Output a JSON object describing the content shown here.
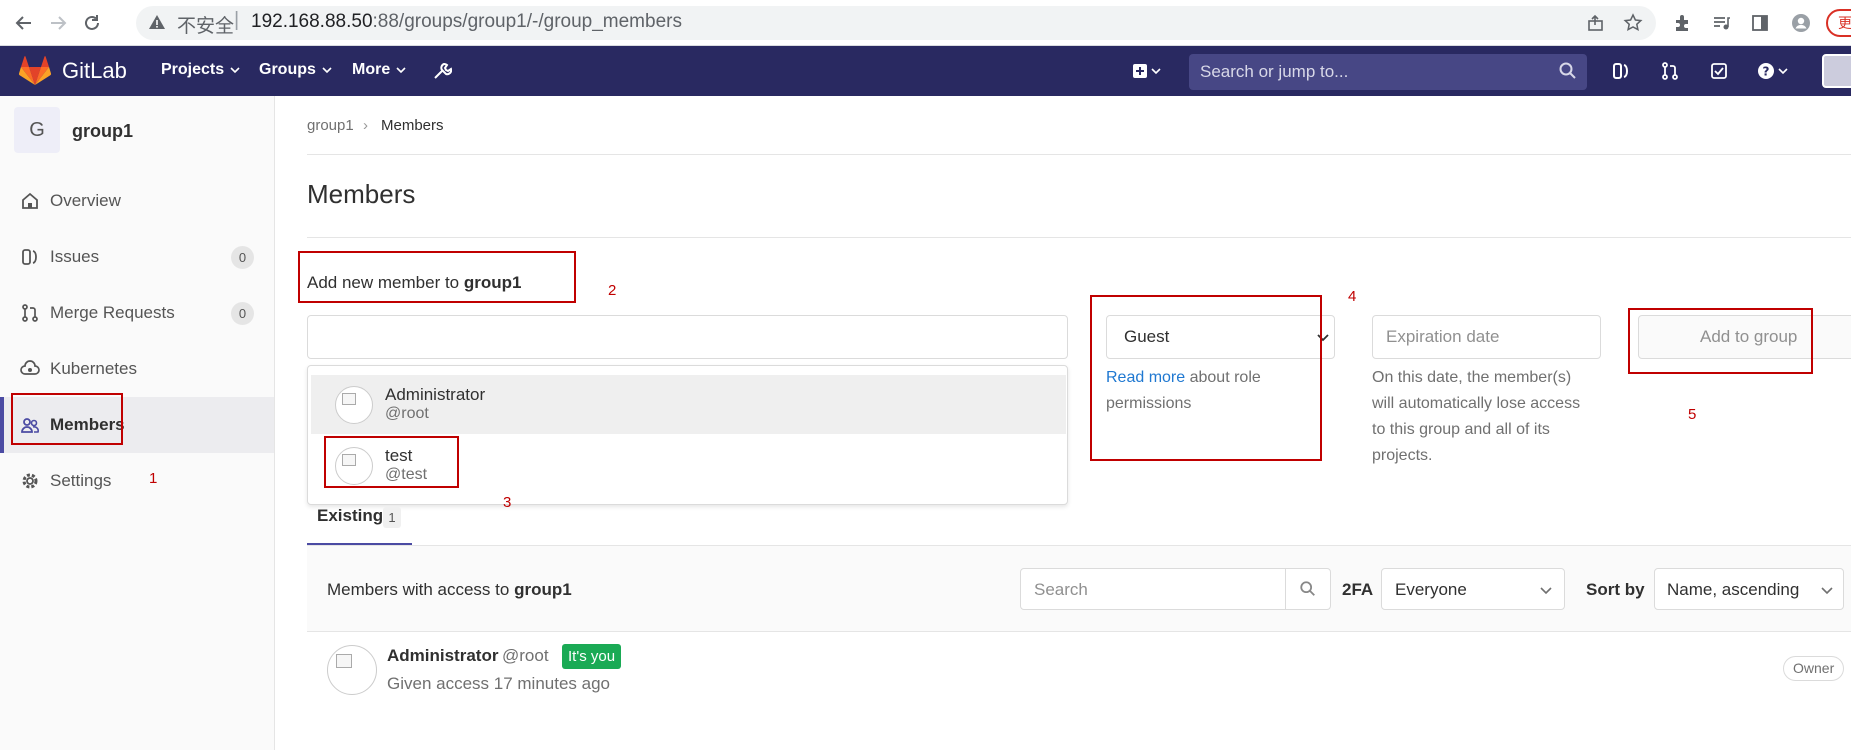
{
  "browser": {
    "insecure_label": "不安全",
    "separator": "|",
    "url_host": "192.168.88.50",
    "url_rest": ":88/groups/group1/-/group_members",
    "profile_char": "更"
  },
  "navbar": {
    "brand": "GitLab",
    "menus": [
      "Projects",
      "Groups",
      "More"
    ],
    "search_placeholder": "Search or jump to...",
    "colors": {
      "bg": "#292961",
      "search_bg": "#474785"
    }
  },
  "sidebar": {
    "group_initial": "G",
    "group_name": "group1",
    "items": [
      {
        "label": "Overview",
        "icon": "home-icon"
      },
      {
        "label": "Issues",
        "icon": "issues-icon",
        "count": "0"
      },
      {
        "label": "Merge Requests",
        "icon": "merge-request-icon",
        "count": "0"
      },
      {
        "label": "Kubernetes",
        "icon": "kubernetes-icon"
      },
      {
        "label": "Members",
        "icon": "users-icon",
        "active": true
      },
      {
        "label": "Settings",
        "icon": "gear-icon"
      }
    ]
  },
  "breadcrumb": {
    "parent": "group1",
    "chevron": "›",
    "current": "Members"
  },
  "page": {
    "title": "Members"
  },
  "add_member": {
    "label_prefix": "Add new member to ",
    "label_group": "group1",
    "suggestions": [
      {
        "name": "Administrator",
        "username": "@root"
      },
      {
        "name": "test",
        "username": "@test"
      }
    ],
    "role_value": "Guest",
    "role_help_link": "Read more",
    "role_help_rest": " about role permissions",
    "expiration_placeholder": "Expiration date",
    "expiration_help": "On this date, the member(s) will automatically lose access to this group and all of its projects.",
    "add_button": "Add to group"
  },
  "annotations": [
    "1",
    "2",
    "3",
    "4",
    "5"
  ],
  "existing": {
    "tab_label": "Existing",
    "tab_count": "1",
    "members_label_prefix": "Members with access to ",
    "members_label_group": "group1",
    "search_placeholder": "Search",
    "twofa_label": "2FA",
    "twofa_value": "Everyone",
    "sort_label": "Sort by",
    "sort_value": "Name, ascending",
    "members": [
      {
        "name": "Administrator",
        "username": "@root",
        "badge": "It's you",
        "access": "Given access 17 minutes ago",
        "role": "Owner"
      }
    ]
  },
  "colors": {
    "annotation_red": "#c00000",
    "link_blue": "#1f78d1",
    "badge_green": "#1aaa55",
    "active_bar": "#4b4ba3"
  }
}
